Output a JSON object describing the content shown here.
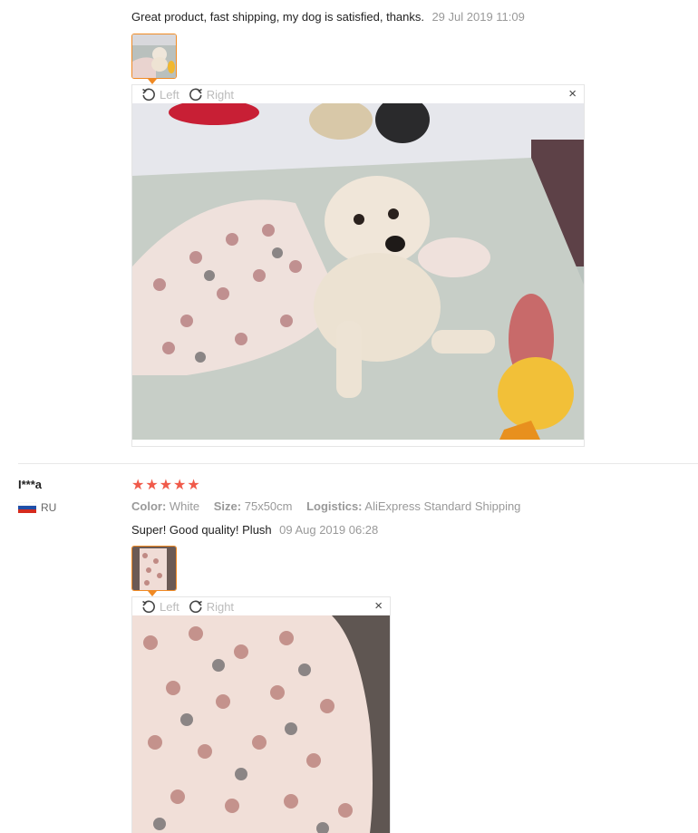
{
  "reviews": [
    {
      "text": "Great product, fast shipping, my dog is satisfied, thanks.",
      "date": "29 Jul 2019 11:09",
      "viewer": {
        "left_label": "Left",
        "right_label": "Right",
        "close_label": "×"
      }
    },
    {
      "user": "I***a",
      "country": "RU",
      "rating_stars": "★★★★★",
      "rating": 5,
      "color_label": "Color:",
      "color_value": "White",
      "size_label": "Size:",
      "size_value": "75x50cm",
      "logistics_label": "Logistics:",
      "logistics_value": "AliExpress Standard Shipping",
      "text": "Super! Good quality! Plush",
      "date": "09 Aug 2019 06:28",
      "viewer": {
        "left_label": "Left",
        "right_label": "Right",
        "close_label": "×"
      }
    }
  ],
  "colors": {
    "accent": "#f08a24",
    "star": "#f05a4a",
    "muted": "#999999"
  },
  "icons": [
    "rotate-left-icon",
    "rotate-right-icon",
    "close-icon",
    "russia-flag-icon"
  ]
}
